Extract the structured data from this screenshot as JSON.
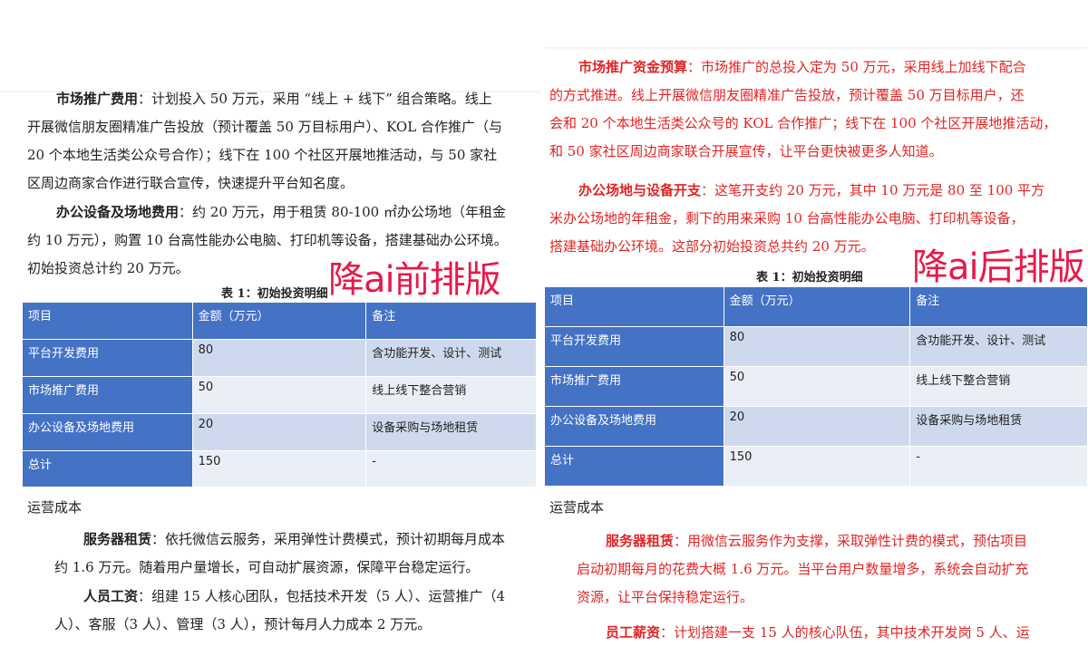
{
  "left": {
    "paragraphs": [
      {
        "title": "市场推广费用",
        "lines": [
          "：计划投入 50 万元，采用 “线上 + 线下” 组合策略。线上",
          "开展微信朋友圈精准广告投放（预计覆盖 50 万目标用户）、KOL 合作推广（与",
          "20 个本地生活类公众号合作）；线下在 100 个社区开展地推活动，与 50 家社",
          "区周边商家合作进行联合宣传，快速提升平台知名度。"
        ]
      },
      {
        "title": "办公设备及场地费用",
        "lines": [
          "：约 20 万元，用于租赁 80-100 ㎡办公场地（年租金",
          "约 10 万元），购置 10 台高性能办公电脑、打印机等设备，搭建基础办公环境。",
          "初始投资总计约 20 万元。"
        ]
      }
    ],
    "watermark": "降ai前排版",
    "table_caption": "表 1：初始投资明细",
    "table": {
      "headers": [
        "项目",
        "金额（万元）",
        "备注"
      ],
      "rows": [
        [
          "平台开发费用",
          "80",
          "含功能开发、设计、测试"
        ],
        [
          "市场推广费用",
          "50",
          "线上线下整合营销"
        ],
        [
          "办公设备及场地费用",
          "20",
          "设备采购与场地租赁"
        ],
        [
          "总计",
          "150",
          "-"
        ]
      ]
    },
    "section_heading": "运营成本",
    "paragraphs2": [
      {
        "title": "服务器租赁",
        "lines": [
          "：依托微信云服务，采用弹性计费模式，预计初期每月成本",
          "约 1.6 万元。随着用户量增长，可自动扩展资源，保障平台稳定运行。"
        ]
      },
      {
        "title": "人员工资",
        "lines": [
          "：组建 15 人核心团队，包括技术开发（5 人）、运营推广（4",
          "人）、客服（3 人）、管理（3 人），预计每月人力成本 2 万元。"
        ]
      }
    ]
  },
  "right": {
    "paragraphs": [
      {
        "title": "市场推广资金预算",
        "lines": [
          "：市场推广的总投入定为 50 万元，采用线上加线下配合",
          "的方式推进。线上开展微信朋友圈精准广告投放，预计覆盖 50 万目标用户，还",
          "会和 20 个本地生活类公众号的 KOL 合作推广；线下在 100 个社区开展地推活动，",
          "和 50 家社区周边商家联合开展宣传，让平台更快被更多人知道。"
        ]
      },
      {
        "title": "办公场地与设备开支",
        "lines": [
          "：这笔开支约 20 万元，其中 10 万元是 80 至 100 平方",
          "米办公场地的年租金，剩下的用来采购 10 台高性能办公电脑、打印机等设备，",
          "搭建基础办公环境。这部分初始投资总共约 20 万元。"
        ]
      }
    ],
    "watermark": "降ai后排版",
    "table_caption": "表 1：初始投资明细",
    "table": {
      "headers": [
        "项目",
        "金额（万元）",
        "备注"
      ],
      "rows": [
        [
          "平台开发费用",
          "80",
          "含功能开发、设计、测试"
        ],
        [
          "市场推广费用",
          "50",
          "线上线下整合营销"
        ],
        [
          "办公设备及场地费用",
          "20",
          "设备采购与场地租赁"
        ],
        [
          "总计",
          "150",
          "-"
        ]
      ]
    },
    "section_heading": "运营成本",
    "paragraphs2": [
      {
        "title": "服务器租赁",
        "lines": [
          "：用微信云服务作为支撑，采取弹性计费的模式，预估项目",
          "启动初期每月的花费大概 1.6 万元。当平台用户数量增多，系统会自动扩充",
          "资源，让平台保持稳定运行。"
        ]
      },
      {
        "title": "员工薪资",
        "lines": [
          "：计划搭建一支 15 人的核心队伍，其中技术开发岗 5 人、运"
        ]
      }
    ]
  }
}
